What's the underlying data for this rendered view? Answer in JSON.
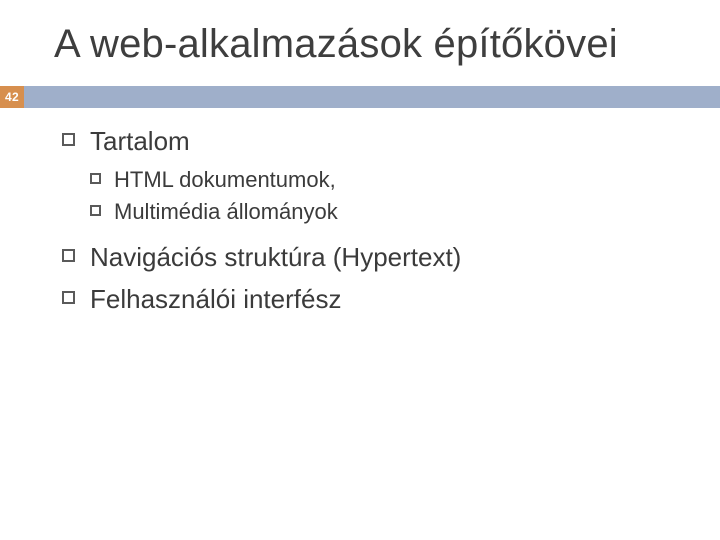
{
  "slide": {
    "title": "A web-alkalmazások építőkövei",
    "page_number": "42",
    "items": [
      {
        "label": "Tartalom",
        "children": [
          {
            "label": "HTML dokumentumok,"
          },
          {
            "label": "Multimédia állományok"
          }
        ]
      },
      {
        "label": "Navigációs struktúra (Hypertext)"
      },
      {
        "label": "Felhasználói interfész"
      }
    ]
  }
}
